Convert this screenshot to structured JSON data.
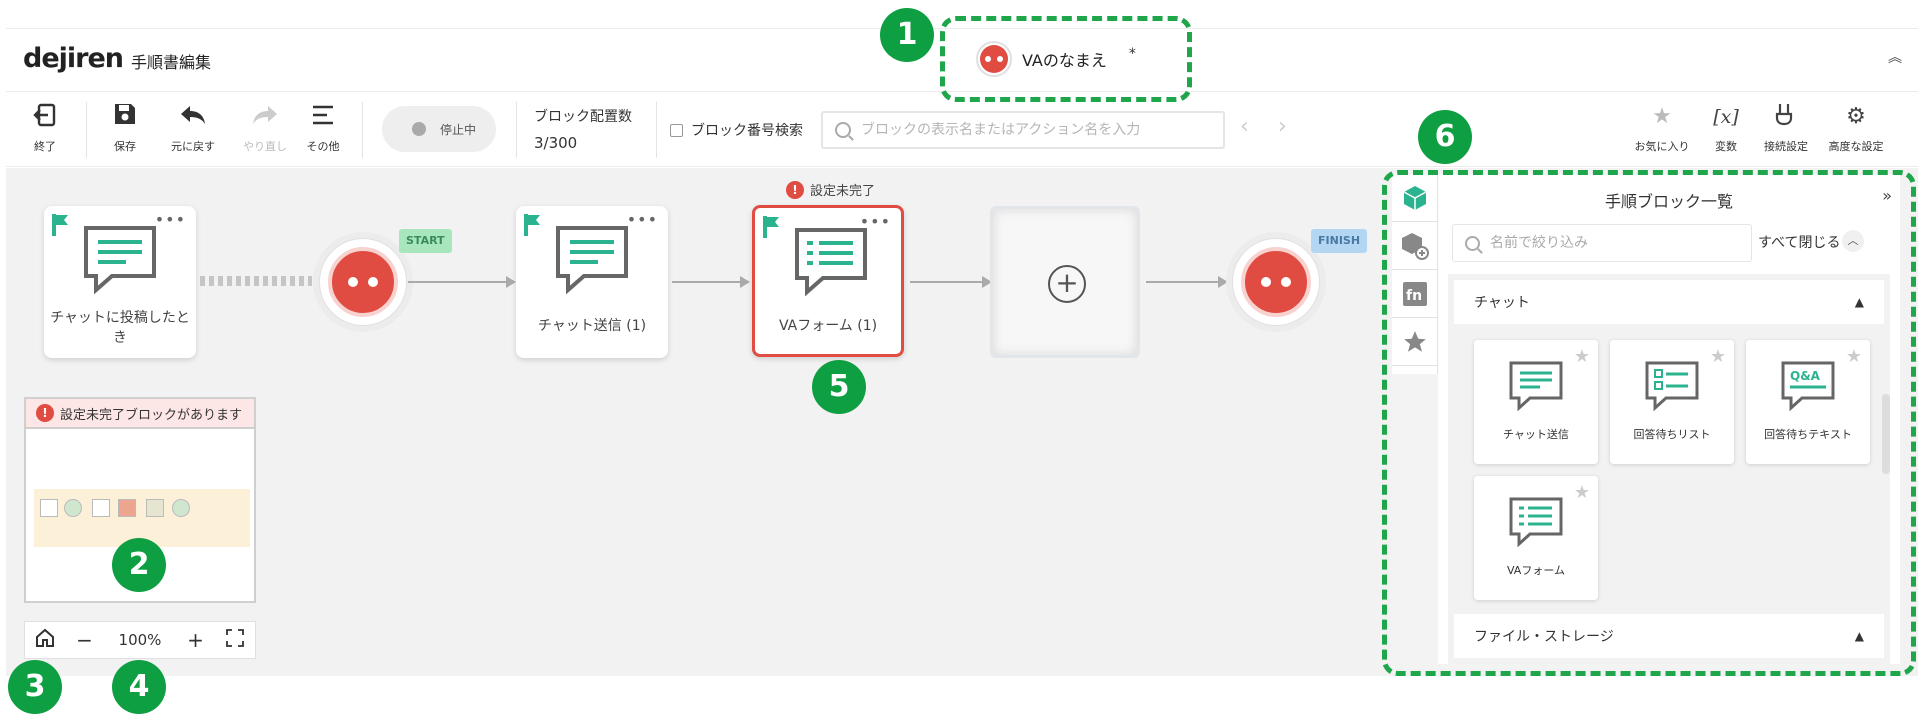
{
  "header": {
    "logo": "dejiren",
    "title": "手順書編集",
    "va_name": "VAのなまえ",
    "unsaved_mark": "*",
    "collapse_icon": "chevron-up-double-icon"
  },
  "toolbar": {
    "exit": "終了",
    "save": "保存",
    "undo": "元に戻す",
    "redo": "やり直し",
    "more": "その他",
    "status": "停止中",
    "block_count_label": "ブロック配置数",
    "block_count_value": "3/300",
    "block_number_search": "ブロック番号検索",
    "search_placeholder": "ブロックの表示名またはアクション名を入力",
    "favorites": "お気に入り",
    "variables": "変数",
    "connection": "接続設定",
    "advanced": "高度な設定"
  },
  "canvas": {
    "error_note": "設定未完了",
    "start_tag": "START",
    "finish_tag": "FINISH",
    "blocks": [
      {
        "label": "チャットに投稿したとき",
        "state": "ok"
      },
      {
        "label": "チャット送信 (1)",
        "state": "ok"
      },
      {
        "label": "VAフォーム (1)",
        "state": "error"
      }
    ],
    "more_dots": "•••"
  },
  "minimap": {
    "warning": "設定未完了ブロックがあります"
  },
  "zoom": {
    "value": "100%",
    "minus": "−",
    "plus": "+"
  },
  "panel": {
    "title": "手順ブロック一覧",
    "filter_placeholder": "名前で絞り込み",
    "close_all": "すべて閉じる",
    "categories": [
      {
        "name": "チャット",
        "expanded": true
      },
      {
        "name": "ファイル・ストレージ",
        "expanded": true
      }
    ],
    "tiles": [
      {
        "label": "チャット送信"
      },
      {
        "label": "回答待ちリスト"
      },
      {
        "label": "回答待ちテキスト"
      },
      {
        "label": "VAフォーム"
      }
    ],
    "qa_text": "Q&A"
  },
  "callouts": [
    "1",
    "2",
    "3",
    "4",
    "5",
    "6"
  ],
  "colors": {
    "accent_green": "#0e9f42",
    "error_red": "#e04c41",
    "block_teal": "#2bb38f"
  }
}
